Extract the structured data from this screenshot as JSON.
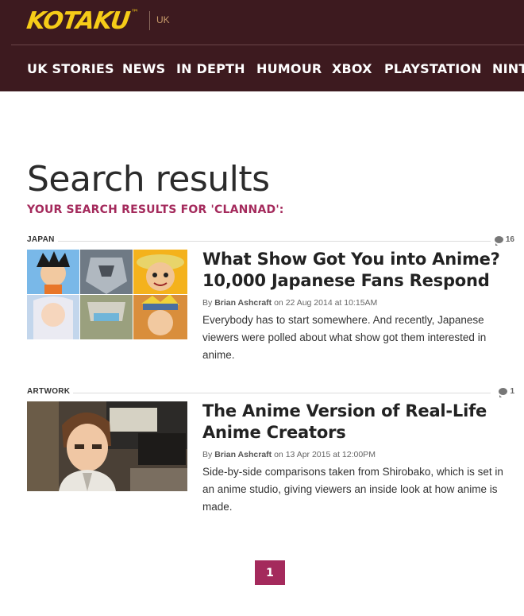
{
  "header": {
    "logo_text": "KOTAKU",
    "logo_tm": "™",
    "edition": "UK",
    "colors": {
      "bar": "#3d1a1f",
      "logo": "#f6cc18",
      "accent": "#a42a5c"
    }
  },
  "nav": {
    "items": [
      {
        "label": "UK STORIES"
      },
      {
        "label": "NEWS"
      },
      {
        "label": "IN DEPTH"
      },
      {
        "label": "HUMOUR"
      },
      {
        "label": "XBOX"
      },
      {
        "label": "PLAYSTATION"
      },
      {
        "label": "NINTENDO"
      }
    ]
  },
  "main": {
    "title": "Search results",
    "subtitle": "YOUR SEARCH RESULTS FOR 'CLANNAD':",
    "results": [
      {
        "category": "JAPAN",
        "comments": "16",
        "title": "What Show Got You into Anime? 10,000 Japanese Fans Respond",
        "by": "By",
        "author": "Brian Ashcraft",
        "date_prefix": "on",
        "date": "22 Aug 2014 at 10:15AM",
        "description": "Everybody has to start somewhere. And recently, Japanese viewers were polled about what show got them interested in anime."
      },
      {
        "category": "ARTWORK",
        "comments": "1",
        "title": "The Anime Version of Real-Life Anime Creators",
        "by": "By",
        "author": "Brian Ashcraft",
        "date_prefix": "on",
        "date": "13 Apr 2015 at 12:00PM",
        "description": "Side-by-side comparisons taken from Shirobako, which is set in an anime studio, giving viewers an inside look at how anime is made."
      }
    ]
  },
  "pagination": {
    "current": "1"
  }
}
